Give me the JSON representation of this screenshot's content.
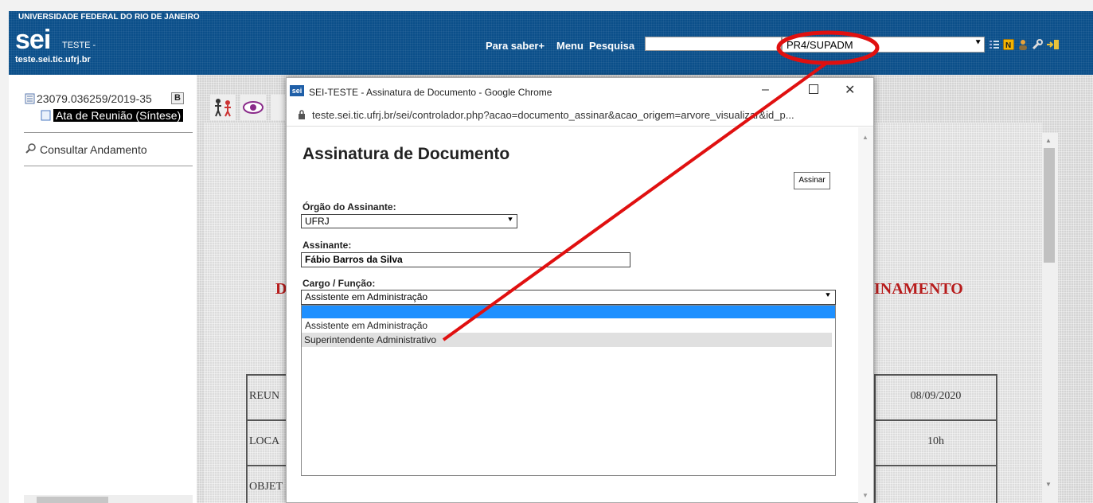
{
  "header": {
    "university": "UNIVERSIDADE FEDERAL DO RIO DE JANEIRO",
    "logo": "sei",
    "env": "TESTE -",
    "domain": "teste.sei.tic.ufrj.br",
    "links": [
      "Para saber+",
      "Menu",
      "Pesquisa"
    ],
    "search_value": "",
    "unit": "PR4/SUPADM",
    "icons": [
      "list-icon",
      "notification-icon",
      "user-icon",
      "wrench-icon",
      "exit-icon"
    ]
  },
  "tree": {
    "process": "23079.036259/2019-35",
    "badge": "B",
    "document": "Ata de Reunião (Síntese)",
    "action": "Consultar Andamento"
  },
  "document": {
    "heading_left": "D",
    "heading_right": "INAMENTO",
    "rows": [
      {
        "label": "REUN",
        "value": "08/09/2020"
      },
      {
        "label": "LOCA",
        "value": "10h"
      },
      {
        "label": "OBJET",
        "value": ""
      }
    ]
  },
  "dialog": {
    "window_title": "SEI-TESTE - Assinatura de Documento - Google Chrome",
    "url": "teste.sei.tic.ufrj.br/sei/controlador.php?acao=documento_assinar&acao_origem=arvore_visualizar&id_p...",
    "title": "Assinatura de Documento",
    "sign_button": "Assinar",
    "orgao_label": "Órgão do Assinante:",
    "orgao_value": "UFRJ",
    "assinante_label": "Assinante:",
    "assinante_value": "Fábio Barros da Silva",
    "cargo_label": "Cargo / Função:",
    "cargo_value": "Assistente em Administração",
    "cargo_options": [
      "",
      "Assistente em Administração",
      "Superintendente Administrativo"
    ]
  },
  "colors": {
    "header_blue": "#0b4f8a",
    "annotation_red": "#e01010",
    "selected_blue": "#1e90ff",
    "doc_red": "#b71c1c"
  }
}
